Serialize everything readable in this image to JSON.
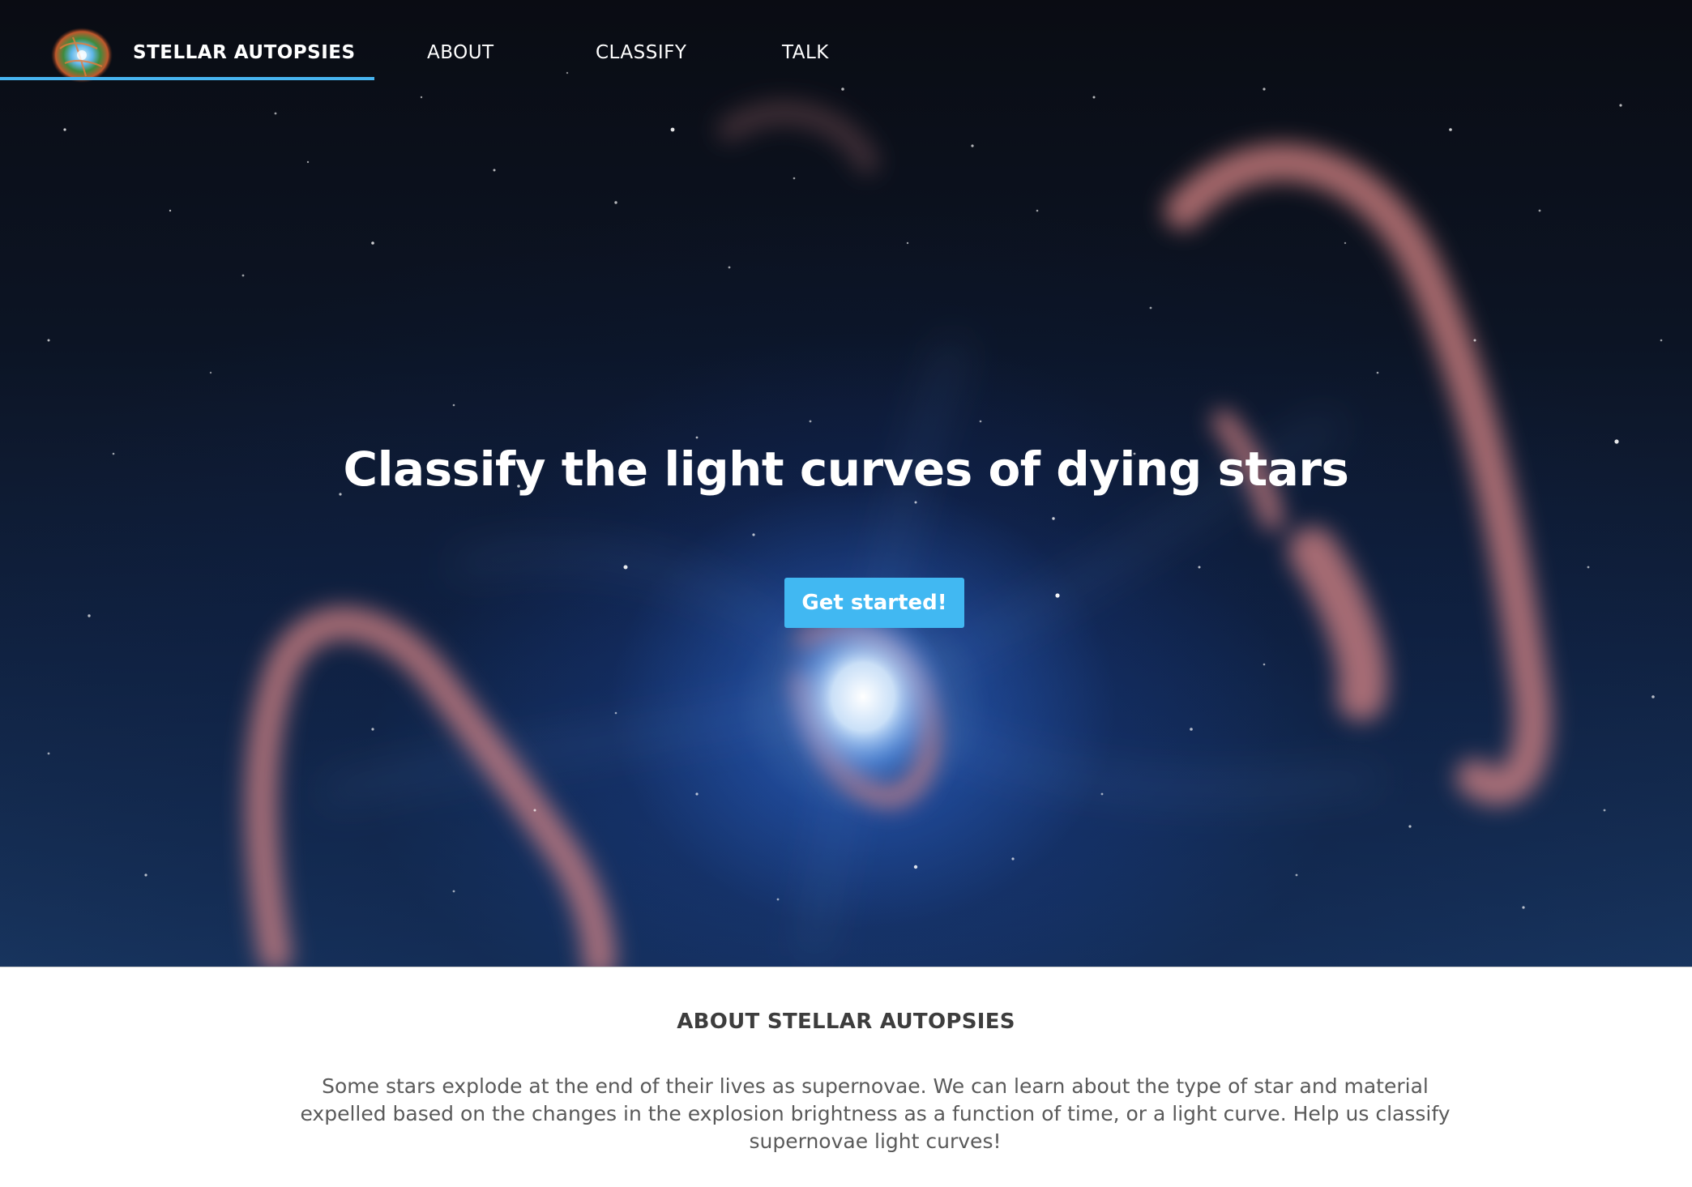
{
  "nav": {
    "brand": "STELLAR AUTOPSIES",
    "links": [
      "ABOUT",
      "CLASSIFY",
      "TALK"
    ]
  },
  "hero": {
    "headline": "Classify the light curves of dying stars",
    "cta_label": "Get started!"
  },
  "about": {
    "title": "ABOUT STELLAR AUTOPSIES",
    "text": "Some stars explode at the end of their lives as supernovae. We can learn about the type of star and material expelled based on the changes in the explosion brightness as a function of time, or a light curve. Help us classify supernovae light curves!"
  },
  "colors": {
    "accent": "#47b4f0",
    "button": "#41b8f2",
    "hero_background": "#0b1426",
    "about_title": "#3d3d3d",
    "about_text": "#5a5a5a"
  },
  "icons": {
    "logo": "crab-nebula-logo"
  }
}
